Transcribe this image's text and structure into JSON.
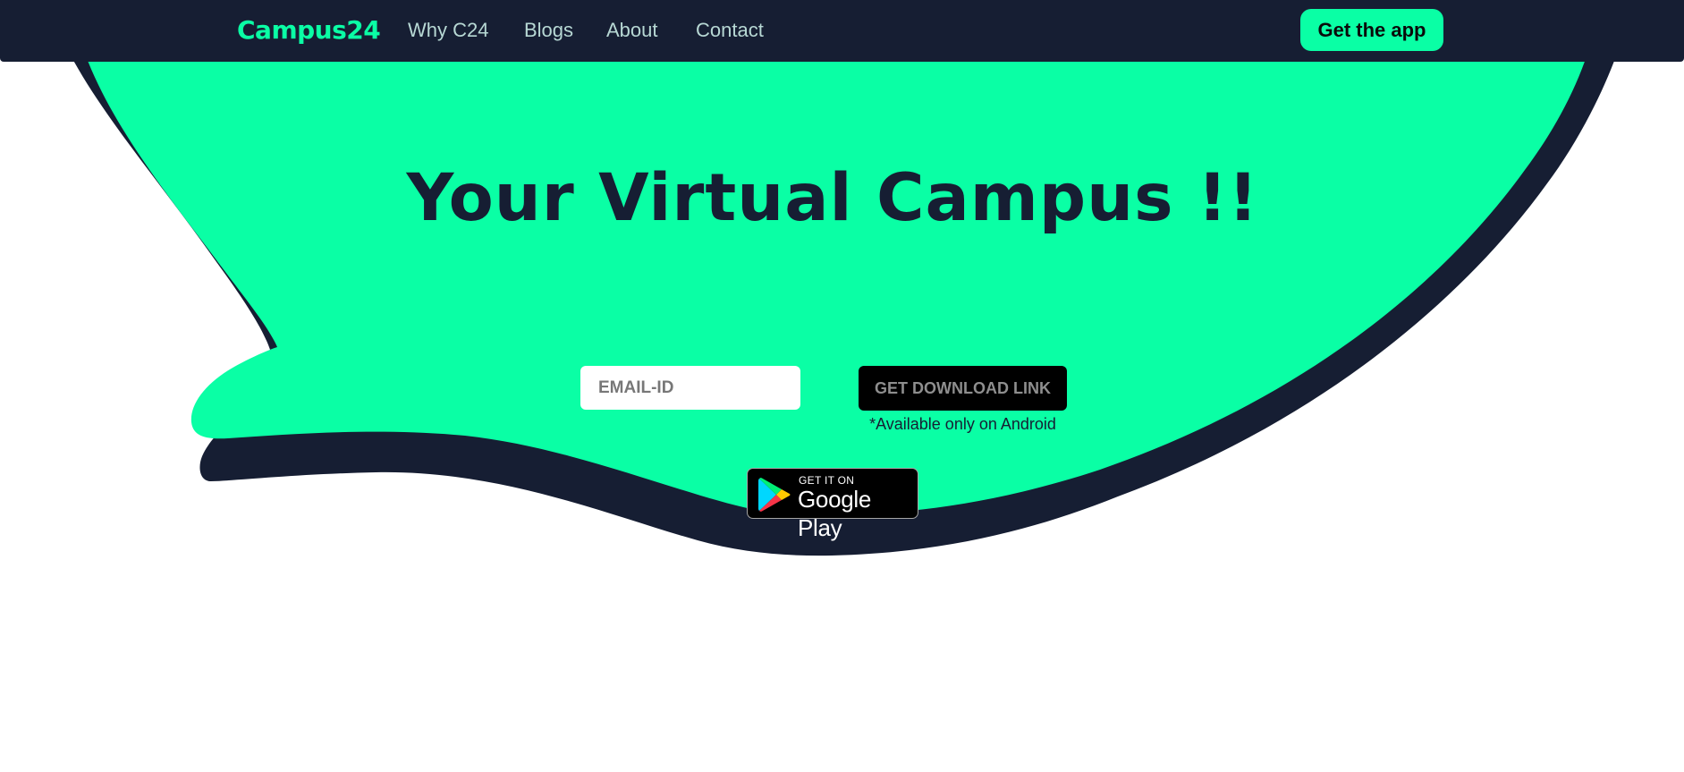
{
  "colors": {
    "navy": "#161e33",
    "mint": "#0affa5",
    "white": "#ffffff",
    "black": "#000000"
  },
  "navbar": {
    "brand": "Campus24",
    "links": [
      {
        "label": "Why C24"
      },
      {
        "label": "Blogs"
      },
      {
        "label": "About"
      },
      {
        "label": "Contact"
      }
    ],
    "cta_label": "Get the app"
  },
  "hero": {
    "title": "Your Virtual Campus !!",
    "email_placeholder": "EMAIL-ID",
    "email_value": "",
    "download_button_label": "GET DOWNLOAD LINK",
    "availability_note": "*Available only on Android",
    "store_badge": {
      "icon": "google-play-icon",
      "small_text": "GET IT ON",
      "large_text": "Google Play"
    }
  }
}
